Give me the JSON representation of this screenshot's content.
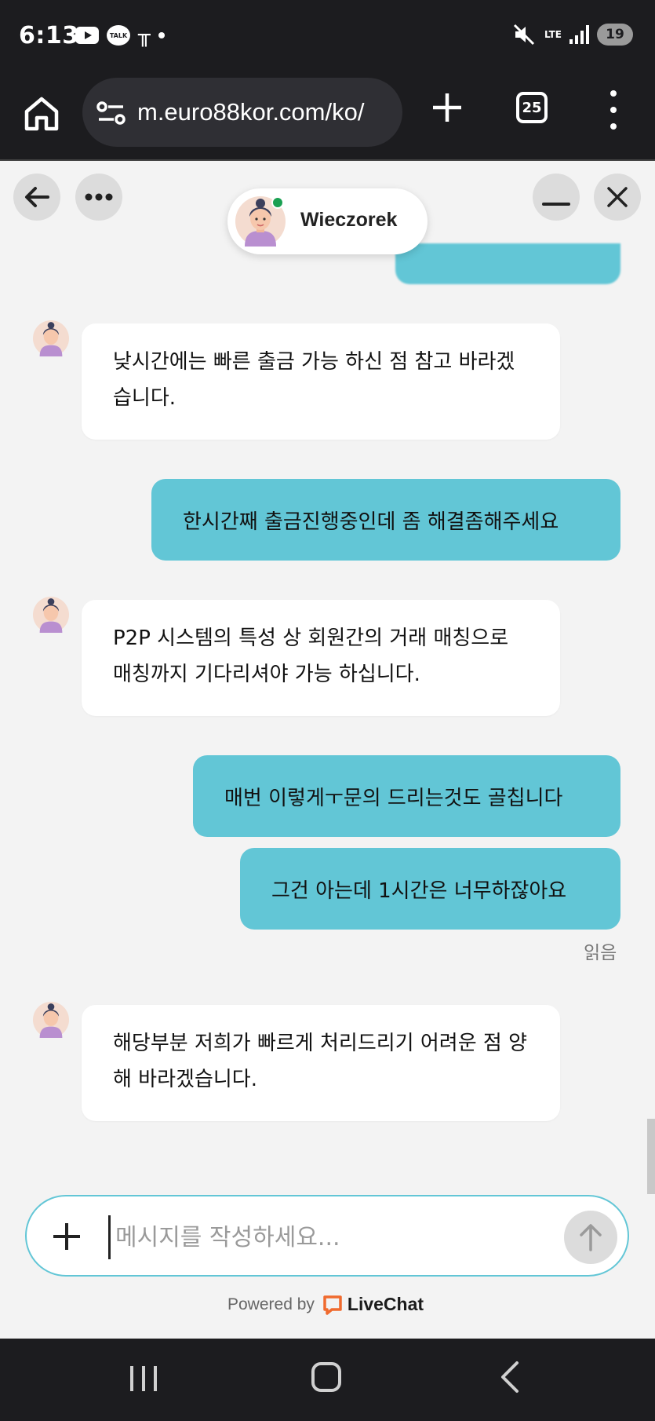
{
  "status_bar": {
    "time": "6:13",
    "talk_badge": "TALK",
    "app_glyph": "╥",
    "network": "LTE",
    "battery": "19"
  },
  "browser": {
    "url": "m.euro88kor.com/ko/",
    "tab_count": "25"
  },
  "chat": {
    "agent_name": "Wieczorek",
    "accent_color": "#62c6d6",
    "online_color": "#1aa052",
    "messages": [
      {
        "from": "agent",
        "text": "낮시간에는 빠른 출금 가능 하신 점 참고 바라겠습니다."
      },
      {
        "from": "user",
        "text": "한시간째 출금진행중인데 좀 해결좀해주세요"
      },
      {
        "from": "agent",
        "text": "P2P 시스템의 특성 상 회원간의 거래 매칭으로 매칭까지 기다리셔야 가능 하십니다."
      },
      {
        "from": "user",
        "text": "매번 이렇게ㅜ문의 드리는것도 골칩니다"
      },
      {
        "from": "user",
        "text": "그건 아는데 1시간은 너무하잖아요"
      },
      {
        "from": "agent",
        "text": "해당부분 저희가 빠르게 처리드리기 어려운 점 양해 바라겠습니다."
      }
    ],
    "read_status": "읽음",
    "input_placeholder": "메시지를 작성하세요...",
    "powered_by": "Powered by",
    "brand": "LiveChat"
  },
  "icons": {
    "home": "home-icon",
    "site_settings": "tune-icon",
    "new_tab": "plus-icon",
    "menu": "more-vert-icon",
    "back": "arrow-left-icon",
    "more": "more-horiz-icon",
    "minimize": "minimize-icon",
    "close": "close-icon",
    "attach": "plus-icon",
    "send": "arrow-up-icon"
  }
}
